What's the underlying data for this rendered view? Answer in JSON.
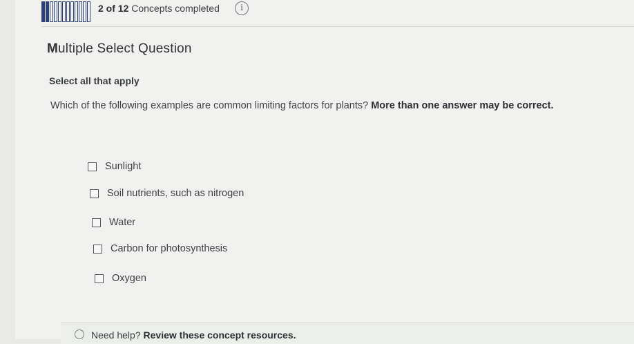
{
  "progress": {
    "completed": 2,
    "total": 12,
    "count_label": "2 of 12",
    "suffix_label": "Concepts completed",
    "info_glyph": "i"
  },
  "question": {
    "type_label": "Multiple Select Question",
    "instruction": "Select all that apply",
    "prompt_text": "Which of the following examples are common limiting factors for plants?",
    "prompt_emphasis": "More than one answer may be correct.",
    "options": [
      {
        "label": "Sunlight",
        "checked": false
      },
      {
        "label": "Soil nutrients, such as nitrogen",
        "checked": false
      },
      {
        "label": "Water",
        "checked": false
      },
      {
        "label": "Carbon for photosynthesis",
        "checked": false
      },
      {
        "label": "Oxygen",
        "checked": false
      }
    ]
  },
  "help": {
    "prefix": "Need help?",
    "link_label": "Review these concept resources."
  },
  "colors": {
    "progress_fill": "#2a3f7c",
    "text": "#3a3d42",
    "background": "#f1f2ef"
  }
}
